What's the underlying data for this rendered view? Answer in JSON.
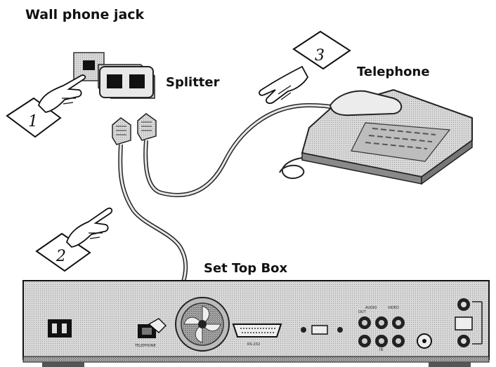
{
  "labels": {
    "wall_jack": "Wall phone jack",
    "splitter": "Splitter",
    "telephone": "Telephone",
    "set_top_box": "Set Top Box"
  },
  "steps": [
    "1",
    "2",
    "3"
  ],
  "rear_panel": {
    "telephone_port": "TELEPHONE",
    "rs232": "RS-232",
    "audio": "AUDIO",
    "video": "VIDEO",
    "out": "OUT",
    "in": "IN"
  },
  "colors": {
    "ink": "#1a1a1a",
    "panel": "#cfcfcf",
    "panel_dark": "#7a7a7a",
    "paper": "#ffffff"
  }
}
